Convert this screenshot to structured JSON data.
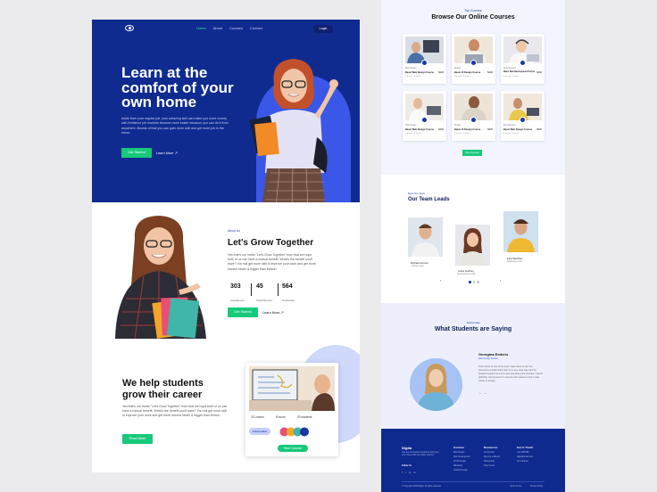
{
  "hero": {
    "nav": [
      "Home",
      "About",
      "Courses",
      "Contact"
    ],
    "login": "Login",
    "title": "Learn at the comfort of your own home",
    "description": "Aside from your regular job, your amazing skill can make you more money with freelance job markets become more easier because you can do it from anywhere. Boosts of that you can gain more skill and get more job in the future.",
    "cta": "Get Started",
    "learn_more": "Learn More",
    "arrow": "↗"
  },
  "about": {
    "tag": "About Us",
    "title": "Let's Grow Together",
    "description": "Yes that's our motto \"Let's Grow Together\" from that we hope both of us can have a mutual benefit. What's the benefit you'll have? You will get more skill to improve your work and get more income faster & bigger than before!",
    "stats": [
      {
        "value": "303",
        "label": "Freelancers"
      },
      {
        "value": "45",
        "label": "Total Mentors"
      },
      {
        "value": "564",
        "label": "Graduates"
      }
    ],
    "cta": "Get Started",
    "learn_more": "Learn More",
    "arrow": "↗"
  },
  "career": {
    "title": "We help students grow their career",
    "description": "Yes that's our motto \"Let's Grow Together\" from that we hope both of us can have a mutual benefit. What's the benefit you'll have? You will get more skill to improve your work and get more income faster & bigger than before.",
    "cta": "Read More",
    "card": {
      "lessons": "22 Lesson",
      "hours": "8 hours",
      "students": "30 students",
      "level": "Intermediate",
      "cta": "Start Course"
    }
  },
  "courses": {
    "tag": "Top Courses",
    "title": "Browse Our Online Courses",
    "cta": "View Courses",
    "items": [
      {
        "category": "Web Design",
        "name": "Basic Web Design Course",
        "price": "$200",
        "meta": "5 lesson · 8 hours"
      },
      {
        "category": "Design",
        "name": "Basic UI Design Course",
        "price": "$200",
        "meta": "5 lesson · 8 hours"
      },
      {
        "category": "Development",
        "name": "Basic Web Development Course",
        "price": "$200",
        "meta": "5 lesson · 8 hours"
      },
      {
        "category": "Web Design",
        "name": "Basic Web Design Course",
        "price": "$200",
        "meta": "5 lesson · 8 hours"
      },
      {
        "category": "Design",
        "name": "Basic UI Design Course",
        "price": "$200",
        "meta": "5 lesson · 8 hours"
      },
      {
        "category": "Development",
        "name": "Basic Web Design Course",
        "price": "$200",
        "meta": "5 lesson · 8 hours"
      }
    ]
  },
  "team": {
    "tag": "Meet Our Team",
    "title": "Our Team Leads",
    "members": [
      {
        "name": "Michael Gunner",
        "role": "Design Lead"
      },
      {
        "name": "Annie Godfrey",
        "role": "Development Lead"
      },
      {
        "name": "Fred Worthley",
        "role": "Marketing Lead"
      }
    ],
    "prev": "‹",
    "next": "›"
  },
  "testimonials": {
    "tag": "Testimonials",
    "title": "What Students are Saying",
    "name": "Georgina Embers",
    "role": "Web Design Student",
    "quote": "This course is one of the best I have done so far, the instructors explain each topic in a very clear way and the projects helped me a lot to put everything into practice. I would definitely recommend it to anyone who wants to start a new career in design.",
    "prev": "←",
    "next": "→"
  },
  "footer": {
    "brand": "Digita",
    "about": "Join our community of learners and grow your career with our online courses.",
    "follow": "Follow Us",
    "columns": [
      {
        "title": "Courses",
        "items": [
          "Web Design",
          "Web Development",
          "UI/UX Design",
          "Marketing",
          "Graphic Design"
        ]
      },
      {
        "title": "Resources",
        "items": [
          "Community",
          "Become a Mentor",
          "Partnership",
          "Help Center"
        ]
      },
      {
        "title": "Get in Touch",
        "items": [
          "+12 3456789",
          "digita@email.com",
          "Our Address"
        ]
      }
    ],
    "copyright": "© Copyright 2023 Digita. All rights reserved",
    "terms": "Terms of Use",
    "privacy": "Privacy Policy"
  },
  "colors": {
    "navy": "#102b8f",
    "green": "#17c97b",
    "blue": "#3a57e8"
  }
}
